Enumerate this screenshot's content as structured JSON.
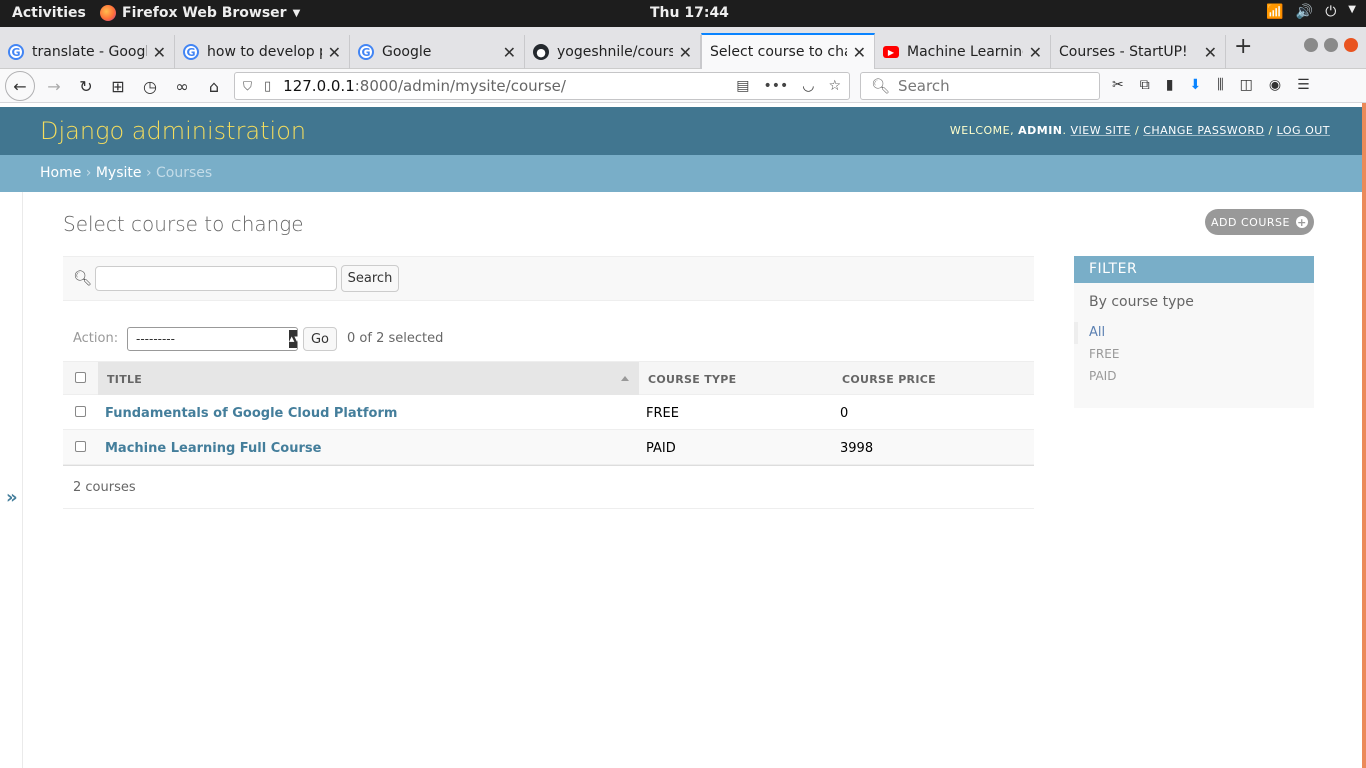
{
  "system": {
    "activities": "Activities",
    "app_menu": "Firefox Web Browser",
    "clock": "Thu 17:44"
  },
  "tabs": [
    {
      "title": "translate - Google",
      "favicon": "google-icon"
    },
    {
      "title": "how to develop p",
      "favicon": "google-icon"
    },
    {
      "title": "Google",
      "favicon": "google-icon"
    },
    {
      "title": "yogeshnile/course",
      "favicon": "github-icon"
    },
    {
      "title": "Select course to chan",
      "favicon": "none",
      "active": true
    },
    {
      "title": "Machine Learning",
      "favicon": "youtube-icon"
    },
    {
      "title": "Courses - StartUP!",
      "favicon": "none"
    }
  ],
  "url": {
    "host": "127.0.0.1",
    "path": ":8000/admin/mysite/course/"
  },
  "search": {
    "placeholder": "Search"
  },
  "django": {
    "brand": "Django administration",
    "welcome": "WELCOME,",
    "user": "ADMIN",
    "view_site": "VIEW SITE",
    "change_password": "CHANGE PASSWORD",
    "log_out": "LOG OUT",
    "breadcrumbs": {
      "home": "Home",
      "mysite": "Mysite",
      "current": "Courses"
    },
    "title": "Select course to change",
    "add_button": "ADD COURSE",
    "search_button": "Search",
    "action_label": "Action:",
    "action_value": "---------",
    "go_button": "Go",
    "selected_count": "0 of 2 selected",
    "columns": [
      "TITLE",
      "COURSE TYPE",
      "COURSE PRICE"
    ],
    "rows": [
      {
        "title": "Fundamentals of Google Cloud Platform",
        "type": "FREE",
        "price": "0"
      },
      {
        "title": "Machine Learning Full Course",
        "type": "PAID",
        "price": "3998"
      }
    ],
    "paginator": "2 courses",
    "filter": {
      "heading": "FILTER",
      "subheading": "By course type",
      "options": [
        "All",
        "FREE",
        "PAID"
      ]
    }
  },
  "colors": {
    "header": "#417690",
    "brand": "#f5dd5d",
    "breadcrumbs": "#79aec8",
    "link": "#447e9b"
  }
}
